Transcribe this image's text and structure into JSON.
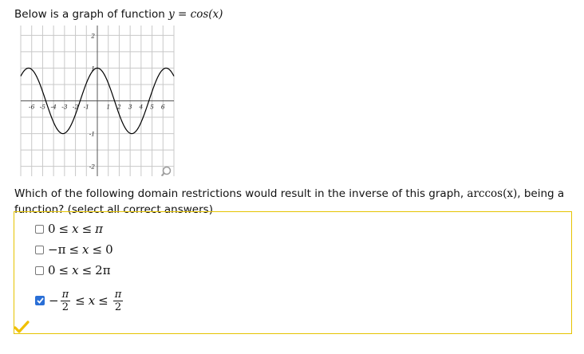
{
  "prompt": {
    "text": "Below is a graph of function",
    "formula": "y = cos(x)"
  },
  "graph": {
    "x_tick_labels": [
      "-6",
      "-5",
      "-4",
      "-3",
      "-2",
      "-1",
      "1",
      "2",
      "3",
      "4",
      "5",
      "6"
    ],
    "y_tick_labels": [
      "2",
      "1",
      "-1",
      "-2"
    ],
    "x_range": [
      -7,
      7
    ],
    "y_range": [
      -2.3,
      2.3
    ],
    "function": "cos",
    "curve_color": "#000000",
    "grid_color": "#c8c8c8",
    "zoom_icon": "magnifier-icon"
  },
  "question": {
    "text_before": "Which of the following domain restrictions would result in the inverse of this graph,",
    "formula": "arccos(x)",
    "text_after": ", being a function? (select all correct answers)"
  },
  "choices": [
    {
      "label": "0 ≤ x ≤ π",
      "checked": false
    },
    {
      "label": "−π ≤ x ≤ 0",
      "checked": false
    },
    {
      "label": "0 ≤ x ≤ 2π",
      "checked": false
    },
    {
      "label": "−π/2 ≤ x ≤ π/2",
      "checked": true
    }
  ],
  "choice_parts": {
    "c1": {
      "a": "0",
      "op1": "≤",
      "v": "x",
      "op2": "≤",
      "b": "π"
    },
    "c2": {
      "a": "−π",
      "op1": "≤",
      "v": "x",
      "op2": "≤",
      "b": "0"
    },
    "c3": {
      "a": "0",
      "op1": "≤",
      "v": "x",
      "op2": "≤",
      "b": "2π"
    },
    "c4": {
      "minus": "−",
      "num": "π",
      "den": "2",
      "op1": "≤",
      "v": "x",
      "op2": "≤",
      "num2": "π",
      "den2": "2"
    }
  },
  "colors": {
    "answer_box_border": "#e6c300",
    "checkbox_checked": "#2a6fd6",
    "correct_mark": "#f0c000"
  },
  "status": {
    "icon": "checkmark-icon",
    "state": "correct"
  }
}
